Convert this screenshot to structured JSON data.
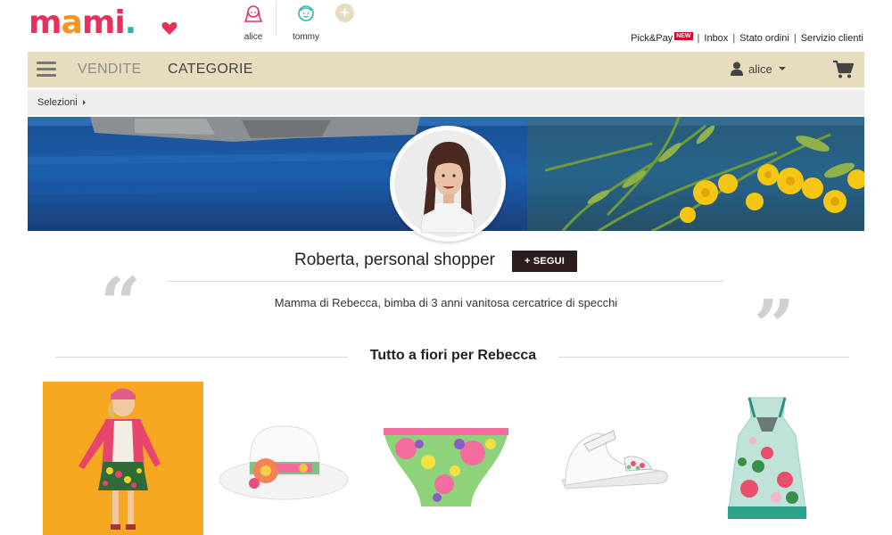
{
  "brand": {
    "logo_letters": [
      "m",
      "a",
      "m",
      "i",
      "."
    ],
    "accent": "#e6325a",
    "teal": "#2fb6a8",
    "orange": "#f7941d"
  },
  "profiles": [
    {
      "name": "alice",
      "icon": "girl-avatar-icon"
    },
    {
      "name": "tommy",
      "icon": "boy-avatar-icon"
    }
  ],
  "add_profile_label": "+",
  "toplinks": {
    "pickpay": "Pick&Pay",
    "pickpay_badge": "NEW",
    "inbox": "Inbox",
    "orders": "Stato ordini",
    "service": "Servizio clienti",
    "separator": "|"
  },
  "nav": {
    "vendite": "VENDITE",
    "categorie": "CATEGORIE",
    "user": "alice",
    "bar_color": "#e8dcbf"
  },
  "breadcrumb": {
    "label": "Selezioni"
  },
  "shopper": {
    "name": "Roberta, personal shopper",
    "follow": "+ SEGUI",
    "bio": "Mamma di Rebecca, bimba di 3 anni vanitosa cercatrice di specchi",
    "quote_open": "“",
    "quote_close": "”"
  },
  "collection": {
    "title": "Tutto a fiori per Rebecca",
    "products": [
      {
        "name": "girl-floral-outfit-image"
      },
      {
        "name": "floral-sun-hat-image"
      },
      {
        "name": "floral-swim-bottom-image"
      },
      {
        "name": "white-floral-sandal-image"
      },
      {
        "name": "floral-dress-image"
      }
    ]
  }
}
